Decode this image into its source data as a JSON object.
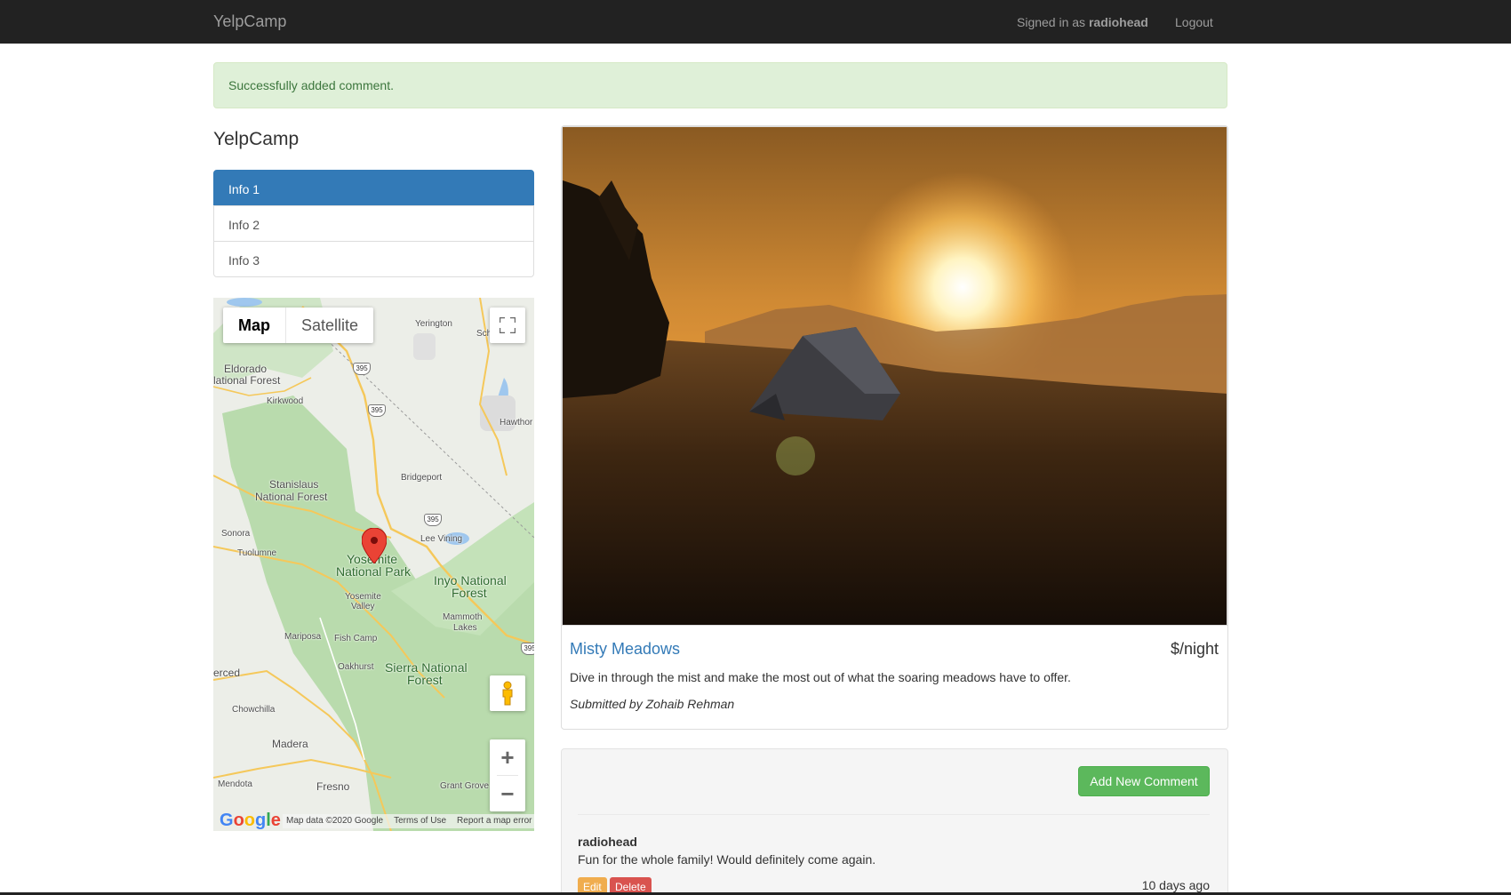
{
  "navbar": {
    "brand": "YelpCamp",
    "signed_in_prefix": "Signed in as ",
    "username": "radiohead",
    "logout": "Logout",
    "background": "#222222"
  },
  "alert": {
    "message": "Successfully added comment.",
    "color": "#dff0d8"
  },
  "sidebar": {
    "title": "YelpCamp",
    "items": [
      {
        "label": "Info 1",
        "active": true
      },
      {
        "label": "Info 2",
        "active": false
      },
      {
        "label": "Info 3",
        "active": false
      }
    ]
  },
  "map": {
    "type_buttons": {
      "map": "Map",
      "satellite": "Satellite"
    },
    "selected_type": "Map",
    "labels": {
      "yerington": "Yerington",
      "sch": "Sch",
      "eldorado": "Eldorado",
      "eldorado2": "lational Forest",
      "kirkwood": "Kirkwood",
      "hawthorne": "Hawthor",
      "stanislaus": "Stanislaus",
      "stanislaus2": "National Forest",
      "bridgeport": "Bridgeport",
      "sonora": "Sonora",
      "tuolumne": "Tuolumne",
      "lee_vining": "Lee Vining",
      "yosemite": "Yosemite",
      "yosemite2": "National Park",
      "inyo": "Inyo National",
      "inyo2": "Forest",
      "yosemite_valley": "Yosemite",
      "yosemite_valley2": "Valley",
      "mammoth": "Mammoth",
      "mammoth2": "Lakes",
      "mariposa": "Mariposa",
      "fish_camp": "Fish Camp",
      "merced": "erced",
      "oakhurst": "Oakhurst",
      "sierra": "Sierra National",
      "sierra2": "Forest",
      "chowchilla": "Chowchilla",
      "madera": "Madera",
      "mendota": "Mendota",
      "fresno": "Fresno",
      "grant_grove": "Grant Grove"
    },
    "shields": [
      "395",
      "395",
      "395",
      "395"
    ],
    "google": "Google",
    "footer": {
      "data": "Map data ©2020 Google",
      "terms": "Terms of Use",
      "report": "Report a map error"
    },
    "icons": [
      "fullscreen-icon",
      "pegman-icon",
      "zoom-in-icon",
      "zoom-out-icon",
      "map-marker-icon"
    ]
  },
  "campground": {
    "name": "Misty Meadows",
    "price": "$/night",
    "description": "Dive in through the mist and make the most out of what the soaring meadows have to offer.",
    "submitted_by": "Submitted by Zohaib Rehman"
  },
  "comments": {
    "add_button": "Add New Comment",
    "items": [
      {
        "author": "radiohead",
        "text": "Fun for the whole family! Would definitely come again.",
        "time": "10 days ago",
        "edit": "Edit",
        "delete": "Delete"
      }
    ]
  }
}
